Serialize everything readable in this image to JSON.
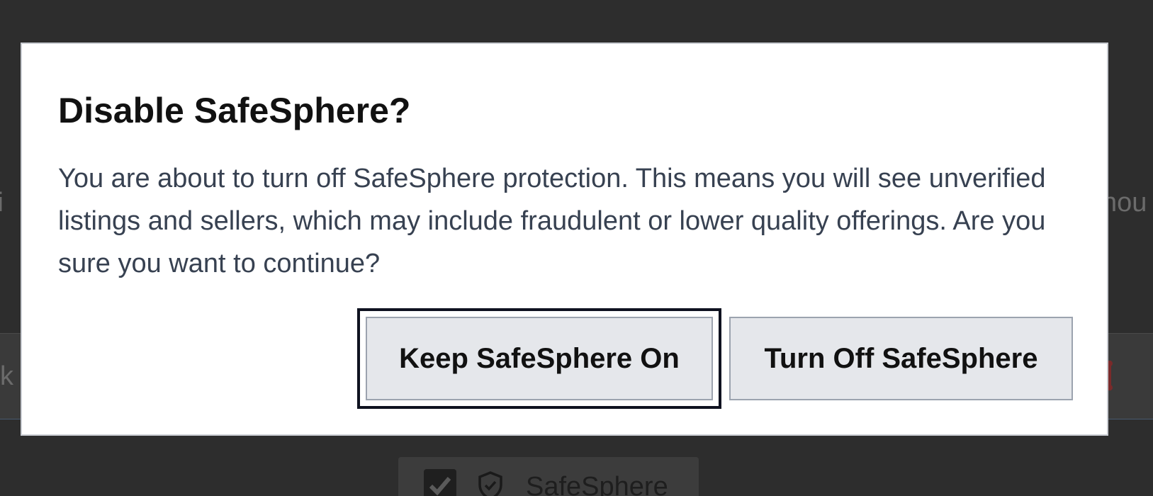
{
  "background": {
    "left_fragment": "fi",
    "right_fragment": "hou",
    "search_fragment": "k",
    "safesphere_toggle": {
      "checked": true,
      "label": "SafeSphere"
    }
  },
  "dialog": {
    "title": "Disable SafeSphere?",
    "message": "You are about to turn off SafeSphere protection. This means you will see unverified listings and sellers, which may include fraudulent or lower quality offerings. Are you sure you want to continue?",
    "buttons": {
      "keep_label": "Keep SafeSphere On",
      "turn_off_label": "Turn Off SafeSphere"
    }
  },
  "colors": {
    "overlay": "#2d2d2d",
    "focus_ring": "#0f1220",
    "button_bg": "#e5e7eb",
    "button_border": "#9ca3af"
  }
}
